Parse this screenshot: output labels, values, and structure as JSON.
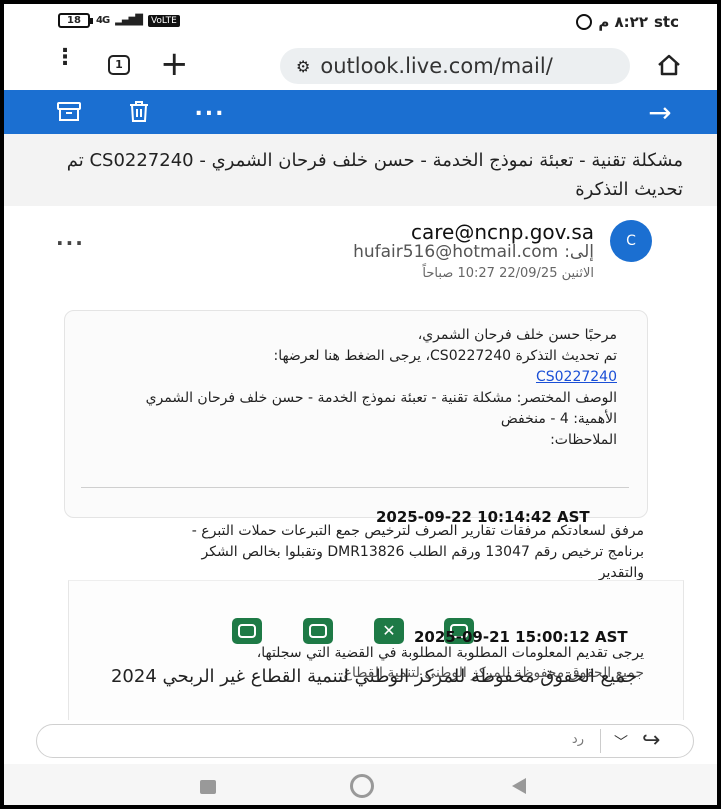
{
  "status": {
    "battery": "18",
    "signal": "4G",
    "volte": "VoLTE",
    "time": "٨:٢٢ م",
    "carrier": "stc"
  },
  "browser": {
    "tab_count": "1",
    "url": "outlook.live.com/mail/"
  },
  "message": {
    "subject": "مشكلة تقنية - تعبئة نموذج الخدمة - حسن خلف فرحان الشمري - CS0227240 تم تحديث التذكرة",
    "avatar_letter": "C",
    "sender": "care@ncnp.gov.sa",
    "recipient_label": "إلى:",
    "recipient": "hufair516@hotmail.com",
    "datetime": "الاثنين 22/09/25 10:27 صباحاً",
    "body": {
      "greeting": "مرحبًا حسن خلف فرحان الشمري،",
      "ticket_line": "تم تحديث التذكرة CS0227240، يرجى الضغط هنا لعرضها:",
      "ticket_link": "CS0227240",
      "desc_line": "الوصف المختصر: مشكلة تقنية - تعبئة نموذج الخدمة - حسن خلف فرحان الشمري",
      "priority_line": "الأهمية: 4 - منخفض",
      "notes_line": "الملاحظات:"
    },
    "update1": {
      "date": "2025-09-22 10:14:42 AST",
      "text": "مرفق لسعادتكم مرفقات تقارير الصرف لترخيص جمع التبرعات حملات التبرع - برنامج ترخيص رقم 13047 ورقم الطلب DMR13826 وتقبلوا بخالص الشكر والتقدير"
    },
    "update2": {
      "date": "2025-09-21 15:00:12 AST",
      "line1": "يرجى تقديم المعلومات المطلوبة المطلوبة في القضية التي سجلتها،",
      "overlap": "جميع الحقوق محفوظة للمركز الوطني لتنمية القطاع"
    },
    "footer": "جميع الحقوق محفوظة للمركز الوطني لتنمية القطاع غير الربحي 2024"
  },
  "reply": {
    "placeholder": "رد"
  },
  "icons": {
    "social": [
      "whatsapp-icon",
      "linkedin-icon",
      "x-icon",
      "youtube-icon"
    ],
    "social_color": "#1e7a46",
    "accent": "#1b6fd1"
  }
}
